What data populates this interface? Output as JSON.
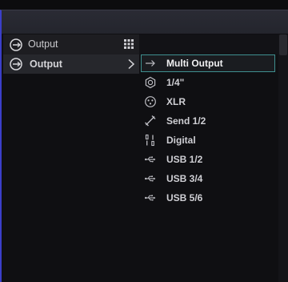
{
  "header": {
    "title": "Output",
    "icon": "output-port-icon",
    "menu_icon": "grid-icon"
  },
  "output_row": {
    "label": "Output",
    "icon": "output-port-icon",
    "expand_icon": "chevron-right-icon"
  },
  "submenu": {
    "items": [
      {
        "label": "Multi Output",
        "icon": "arrow-right-icon",
        "selected": true
      },
      {
        "label": "1/4\"",
        "icon": "quarter-inch-jack-icon"
      },
      {
        "label": "XLR",
        "icon": "xlr-connector-icon"
      },
      {
        "label": "Send 1/2",
        "icon": "send-cable-icon"
      },
      {
        "label": "Digital",
        "icon": "digital-icon"
      },
      {
        "label": "USB 1/2",
        "icon": "usb-icon"
      },
      {
        "label": "USB 3/4",
        "icon": "usb-icon"
      },
      {
        "label": "USB 5/6",
        "icon": "usb-icon"
      }
    ]
  },
  "colors": {
    "accent_border": "#3b3fc9",
    "selected_border": "#3f8f8f"
  }
}
